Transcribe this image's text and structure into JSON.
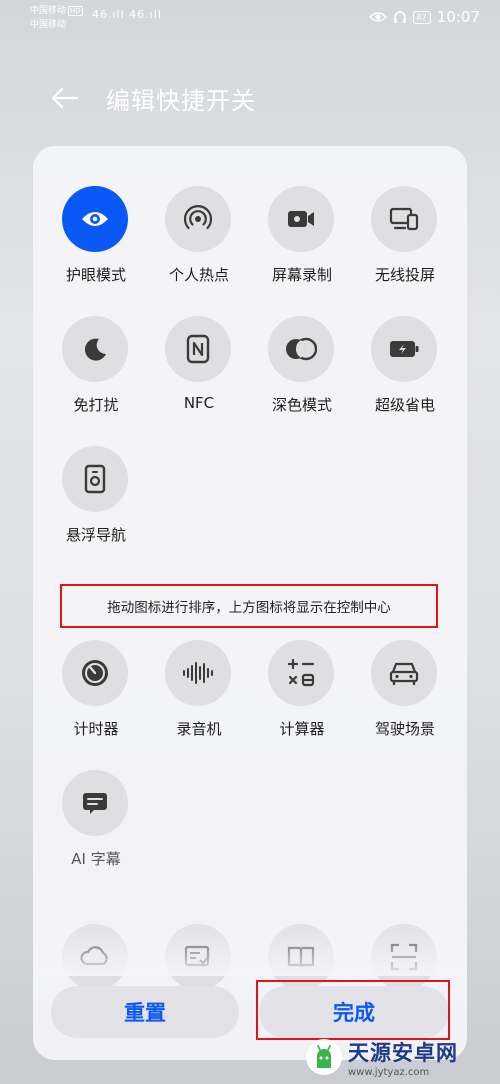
{
  "status_bar": {
    "carrier_1": "中国移动",
    "carrier_2": "中国移动",
    "hd_badge": "HD",
    "signal_1": "46.ıll",
    "signal_2": "46.ıll",
    "battery": "87",
    "time": "10:07"
  },
  "header": {
    "title": "编辑快捷开关"
  },
  "active_tiles": [
    {
      "label": "护眼模式",
      "icon": "eye-icon",
      "active": true
    },
    {
      "label": "个人热点",
      "icon": "hotspot-icon"
    },
    {
      "label": "屏幕录制",
      "icon": "video-camera-icon"
    },
    {
      "label": "无线投屏",
      "icon": "screen-cast-icon"
    },
    {
      "label": "免打扰",
      "icon": "moon-icon"
    },
    {
      "label": "NFC",
      "icon": "nfc-icon"
    },
    {
      "label": "深色模式",
      "icon": "dark-mode-icon"
    },
    {
      "label": "超级省电",
      "icon": "power-saving-battery-icon"
    },
    {
      "label": "悬浮导航",
      "icon": "floating-navigation-icon"
    }
  ],
  "hint": "拖动图标进行排序，上方图标将显示在控制中心",
  "inactive_tiles": [
    {
      "label": "计时器",
      "icon": "timer-icon"
    },
    {
      "label": "录音机",
      "icon": "sound-wave-icon"
    },
    {
      "label": "计算器",
      "icon": "calculator-icon"
    },
    {
      "label": "驾驶场景",
      "icon": "car-icon"
    },
    {
      "label": "AI 字幕",
      "icon": "subtitle-icon"
    }
  ],
  "buttons": {
    "reset": "重置",
    "done": "完成"
  },
  "watermark": {
    "name": "天源安卓网",
    "url": "www.jytyaz.com"
  },
  "colors": {
    "accent": "#0a59f7",
    "highlight_box": "#e0141e"
  }
}
